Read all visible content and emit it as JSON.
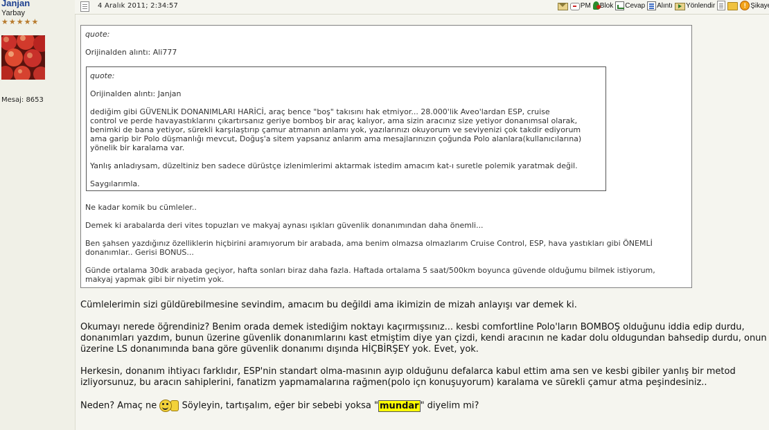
{
  "user": {
    "name": "Janjan",
    "rank": "Yarbay",
    "stars": [
      "★",
      "★",
      "★",
      "★",
      "★"
    ],
    "post_count": "Mesaj: 8653"
  },
  "header": {
    "date": "4 Aralık 2011; 2:34:57",
    "actions": [
      {
        "label": "",
        "icon": "mail-icon"
      },
      {
        "label": "PM",
        "icon": "pm-icon"
      },
      {
        "label": "Blok",
        "icon": "block-icon"
      },
      {
        "label": "Cevap",
        "icon": "reply-icon"
      },
      {
        "label": "Alıntı",
        "icon": "quote-icon"
      },
      {
        "label": "Yönlendir",
        "icon": "forward-icon"
      },
      {
        "label": "",
        "icon": "document-icon"
      },
      {
        "label": "",
        "icon": "folder-icon"
      },
      {
        "label": "Şikayet",
        "icon": "warning-icon"
      }
    ]
  },
  "outer_quote": {
    "title": "quote:",
    "source": "Orijinalden alıntı: Ali777",
    "lines": [
      "Ne kadar komik bu cümleler..",
      "Demek ki arabalarda deri vites topuzları ve makyaj aynası ışıkları güvenlik donanımından daha önemli...",
      "Ben şahsen yazdığınız özelliklerin hiçbirini aramıyorum bir arabada, ama benim olmazsa olmazlarım Cruise Control, ESP, hava yastıkları gibi ÖNEMLİ",
      "donanımlar.. Gerisi BONUS...",
      "Günde ortalama 30dk arabada geçiyor, hafta sonları biraz daha fazla. Haftada ortalama 5 saat/500km boyunca güvende olduğumu bilmek istiyorum,",
      "makyaj yapmak gibi bir niyetim yok."
    ]
  },
  "inner_quote": {
    "title": "quote:",
    "source": "Orijinalden alıntı: Janjan",
    "lines": [
      "dediğim gibi GÜVENLİK DONANIMLARI HARİCİ, araç bence \"boş\" takısını hak etmiyor... 28.000'lik Aveo'lardan ESP, cruise",
      "control ve perde havayastıklarını çıkartırsanız geriye bomboş bir araç kalıyor, ama sizin aracınız size yetiyor donanımsal olarak,",
      "benimki de bana yetiyor, sürekli karşılaştırıp çamur atmanın anlamı yok, yazılarınızı okuyorum ve seviyenizi çok takdir ediyorum",
      "ama garip bir Polo düşmanlığı mevcut, Doğuş'a sitem yapsanız anlarım ama mesajlarınızın çoğunda Polo alanlara(kullanıcılarına)",
      "yönelik bir karalama var.",
      "Yanlış anladıysam, düzeltiniz ben sadece dürüstçe izlenimlerimi aktarmak istedim amacım kat-ı suretle polemik yaratmak değil.",
      "Saygılarımla."
    ]
  },
  "body": {
    "p1": "Cümlelerimin sizi güldürebilmesine sevindim, amacım bu değildi ama ikimizin de mizah anlayışı var demek ki.",
    "p2_l1": "Okumayı nerede öğrendiniz? Benim orada demek istediğim noktayı kaçırmışsınız... kesbi comfortline Polo'ların BOMBOŞ olduğunu iddia edip durdu,",
    "p2_l2": "donanımları yazdım, bunun üzerine güvenlik donanımlarını kast etmiştim diye yan çizdi, kendi aracının ne kadar dolu oldugundan bahsedip durdu, onun",
    "p2_l3": "üzerine LS donanımında bana göre güvenlik donanımı dışında HİÇBİRŞEY yok. Evet, yok.",
    "p3_l1": "Herkesin, donanım ihtiyacı farklıdır, ESP'nin standart olma-masının ayıp olduğunu defalarca kabul ettim ama sen ve kesbi gibiler yanlış bir metod",
    "p3_l2": "izliyorsunuz, bu aracın sahiplerini, fanatizm yapmamalarına rağmen(polo içn konuşuyorum) karalama ve sürekli çamur atma peşindesiniz..",
    "p4_a": "Neden? Amaç ne",
    "p4_b": "Söyleyin, tartışalım, eğer bir sebebi yoksa \"",
    "p4_highlight": "mundar",
    "p4_c": "\" diyelim mi?"
  }
}
